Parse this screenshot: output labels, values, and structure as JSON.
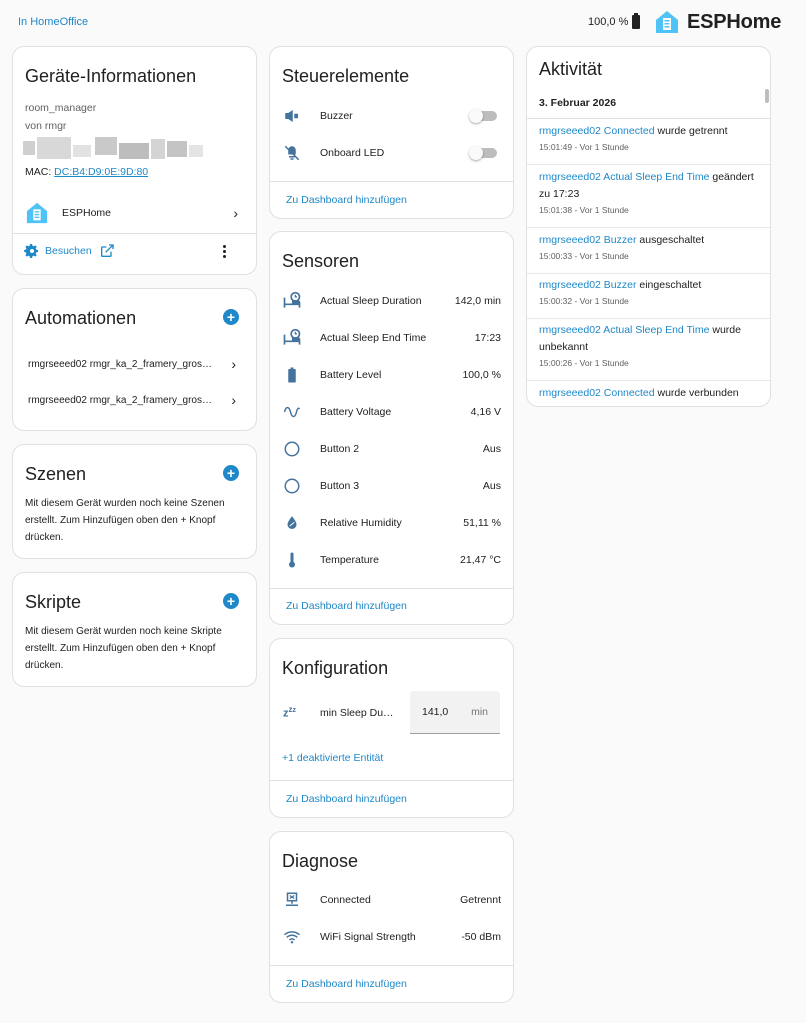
{
  "header": {
    "breadcrumb": "In HomeOffice",
    "battery": "100,0 %",
    "brand": "ESPHome"
  },
  "device_info": {
    "title": "Geräte-Informationen",
    "model": "room_manager",
    "manufacturer": "von rmgr",
    "mac_label": "MAC:",
    "mac_value": "DC:B4:D9:0E:9D:80",
    "integration": "ESPHome",
    "visit_label": "Besuchen"
  },
  "automations": {
    "title": "Automationen",
    "items": [
      "rmgrseeed02 rmgr_ka_2_framery_gros…",
      "rmgrseeed02 rmgr_ka_2_framery_gros…"
    ]
  },
  "scenes": {
    "title": "Szenen",
    "text": "Mit diesem Gerät wurden noch keine Szenen erstellt. Zum Hinzufügen oben den + Knopf drücken."
  },
  "scripts": {
    "title": "Skripte",
    "text": "Mit diesem Gerät wurden noch keine Skripte erstellt. Zum Hinzufügen oben den + Knopf drücken."
  },
  "controls": {
    "title": "Steuerelemente",
    "items": [
      {
        "name": "Buzzer",
        "icon": "buzzer-icon",
        "state": false
      },
      {
        "name": "Onboard LED",
        "icon": "led-off-icon",
        "state": false
      }
    ],
    "add_dashboard": "Zu Dashboard hinzufügen"
  },
  "sensors": {
    "title": "Sensoren",
    "items": [
      {
        "name": "Actual Sleep Duration",
        "value": "142,0 min",
        "icon": "bed-clock-icon"
      },
      {
        "name": "Actual Sleep End Time",
        "value": "17:23",
        "icon": "bed-clock-icon"
      },
      {
        "name": "Battery Level",
        "value": "100,0 %",
        "icon": "battery-icon"
      },
      {
        "name": "Battery Voltage",
        "value": "4,16 V",
        "icon": "sine-wave-icon"
      },
      {
        "name": "Button 2",
        "value": "Aus",
        "icon": "circle-outline-icon"
      },
      {
        "name": "Button 3",
        "value": "Aus",
        "icon": "circle-outline-icon"
      },
      {
        "name": "Relative Humidity",
        "value": "51,11 %",
        "icon": "water-percent-icon"
      },
      {
        "name": "Temperature",
        "value": "21,47 °C",
        "icon": "thermometer-icon"
      }
    ],
    "add_dashboard": "Zu Dashboard hinzufügen"
  },
  "configuration": {
    "title": "Konfiguration",
    "entity_name": "min Sleep Du…",
    "entity_value": "141,0",
    "entity_unit": "min",
    "disabled_link": "+1 deaktivierte Entität",
    "add_dashboard": "Zu Dashboard hinzufügen"
  },
  "diagnostics": {
    "title": "Diagnose",
    "items": [
      {
        "name": "Connected",
        "value": "Getrennt",
        "icon": "lan-disconnect-icon"
      },
      {
        "name": "WiFi Signal Strength",
        "value": "-50 dBm",
        "icon": "wifi-icon"
      }
    ],
    "add_dashboard": "Zu Dashboard hinzufügen"
  },
  "activity": {
    "title": "Aktivität",
    "date": "3. Februar 2026",
    "entries": [
      {
        "entity": "rmgrseeed02 Connected",
        "text": " wurde getrennt",
        "time": "15:01:49 - Vor 1 Stunde"
      },
      {
        "entity": "rmgrseeed02 Actual Sleep End Time",
        "text": " geändert zu 17:23",
        "time": "15:01:38 - Vor 1 Stunde"
      },
      {
        "entity": "rmgrseeed02 Buzzer",
        "text": " ausgeschaltet",
        "time": "15:00:33 - Vor 1 Stunde"
      },
      {
        "entity": "rmgrseeed02 Buzzer",
        "text": " eingeschaltet",
        "time": "15:00:32 - Vor 1 Stunde"
      },
      {
        "entity": "rmgrseeed02 Actual Sleep End Time",
        "text": " wurde unbekannt",
        "time": "15:00:26 - Vor 1 Stunde"
      },
      {
        "entity": "rmgrseeed02 Connected",
        "text": " wurde verbunden",
        "time": ""
      }
    ]
  },
  "colors": {
    "accent": "#1e88c8",
    "icon": "#44739e"
  }
}
